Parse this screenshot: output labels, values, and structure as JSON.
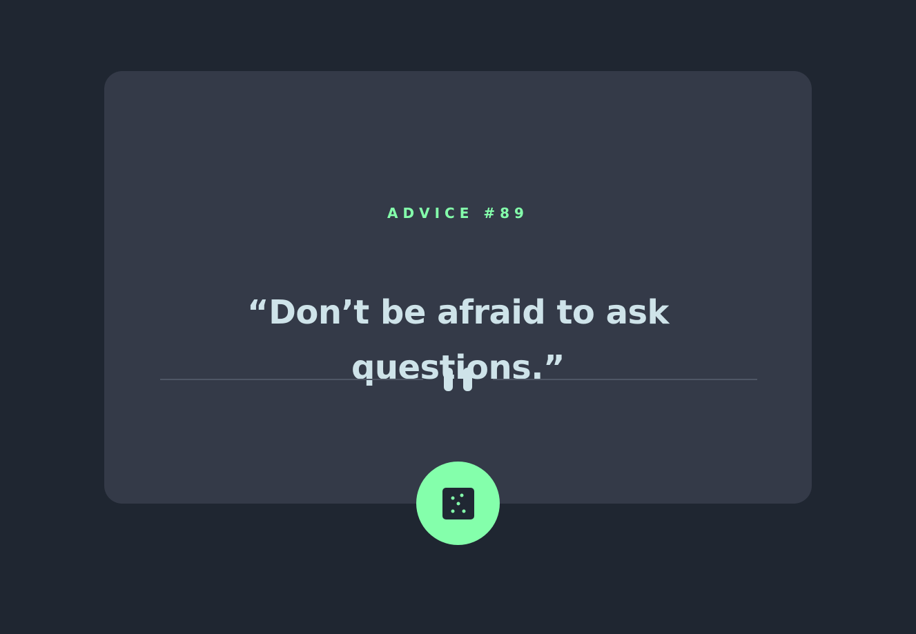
{
  "advice": {
    "label": "ADVICE #89",
    "quote": "“Don’t be afraid to ask questions.”"
  },
  "icons": {
    "divider": "pause-divider-icon",
    "button": "dice-icon"
  },
  "colors": {
    "page_background": "#1f2631",
    "card_background": "#343a48",
    "accent_green": "#84ffab",
    "quote_text": "#cee3e9",
    "divider_line": "#4f5665"
  }
}
